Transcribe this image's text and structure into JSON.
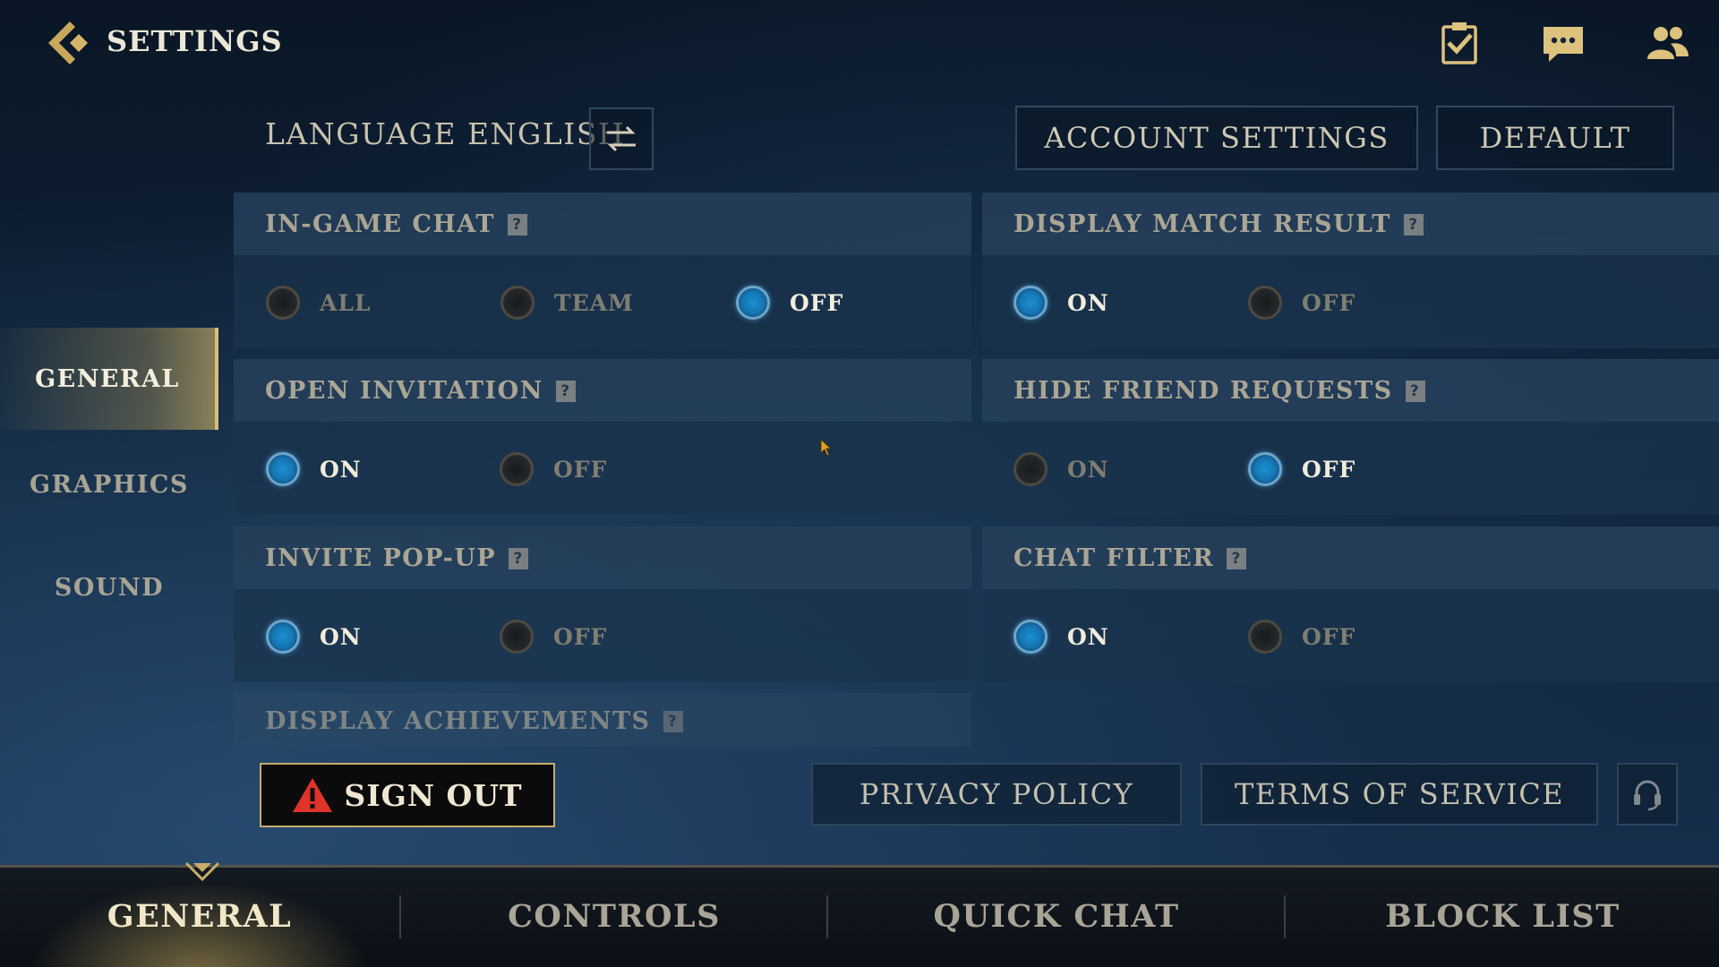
{
  "header": {
    "title": "SETTINGS",
    "icons": [
      "back-icon",
      "missions-icon",
      "chat-icon",
      "friends-icon"
    ]
  },
  "language": {
    "label": "LANGUAGE ENGLISH",
    "toggle_icon": "swap-icon"
  },
  "top_buttons": {
    "account": "ACCOUNT SETTINGS",
    "default": "DEFAULT"
  },
  "sidebar": {
    "items": [
      {
        "label": "GENERAL",
        "active": true
      },
      {
        "label": "GRAPHICS",
        "active": false
      },
      {
        "label": "SOUND",
        "active": false
      }
    ]
  },
  "settings": {
    "in_game_chat": {
      "title": "IN-GAME CHAT",
      "options": [
        "ALL",
        "TEAM",
        "OFF"
      ],
      "selected": "OFF"
    },
    "display_match_result": {
      "title": "DISPLAY MATCH RESULT",
      "options": [
        "ON",
        "OFF"
      ],
      "selected": "ON"
    },
    "open_invitation": {
      "title": "OPEN INVITATION",
      "options": [
        "ON",
        "OFF"
      ],
      "selected": "ON"
    },
    "hide_friend_requests": {
      "title": "HIDE FRIEND REQUESTS",
      "options": [
        "ON",
        "OFF"
      ],
      "selected": "OFF"
    },
    "invite_popup": {
      "title": "INVITE POP-UP",
      "options": [
        "ON",
        "OFF"
      ],
      "selected": "ON"
    },
    "chat_filter": {
      "title": "CHAT FILTER",
      "options": [
        "ON",
        "OFF"
      ],
      "selected": "ON"
    },
    "display_achievements": {
      "title": "DISPLAY ACHIEVEMENTS"
    },
    "help_glyph": "?"
  },
  "actions": {
    "sign_out": "SIGN OUT",
    "privacy_policy": "PRIVACY POLICY",
    "terms_of_service": "TERMS OF SERVICE",
    "support_icon": "headset-icon"
  },
  "tabs": [
    {
      "label": "GENERAL",
      "active": true
    },
    {
      "label": "CONTROLS",
      "active": false
    },
    {
      "label": "QUICK CHAT",
      "active": false
    },
    {
      "label": "BLOCK LIST",
      "active": false
    }
  ],
  "colors": {
    "accent_gold": "#d9bf78",
    "radio_on": "#1a8fd0",
    "warning_red": "#e0332a",
    "background": "#0f2237"
  }
}
